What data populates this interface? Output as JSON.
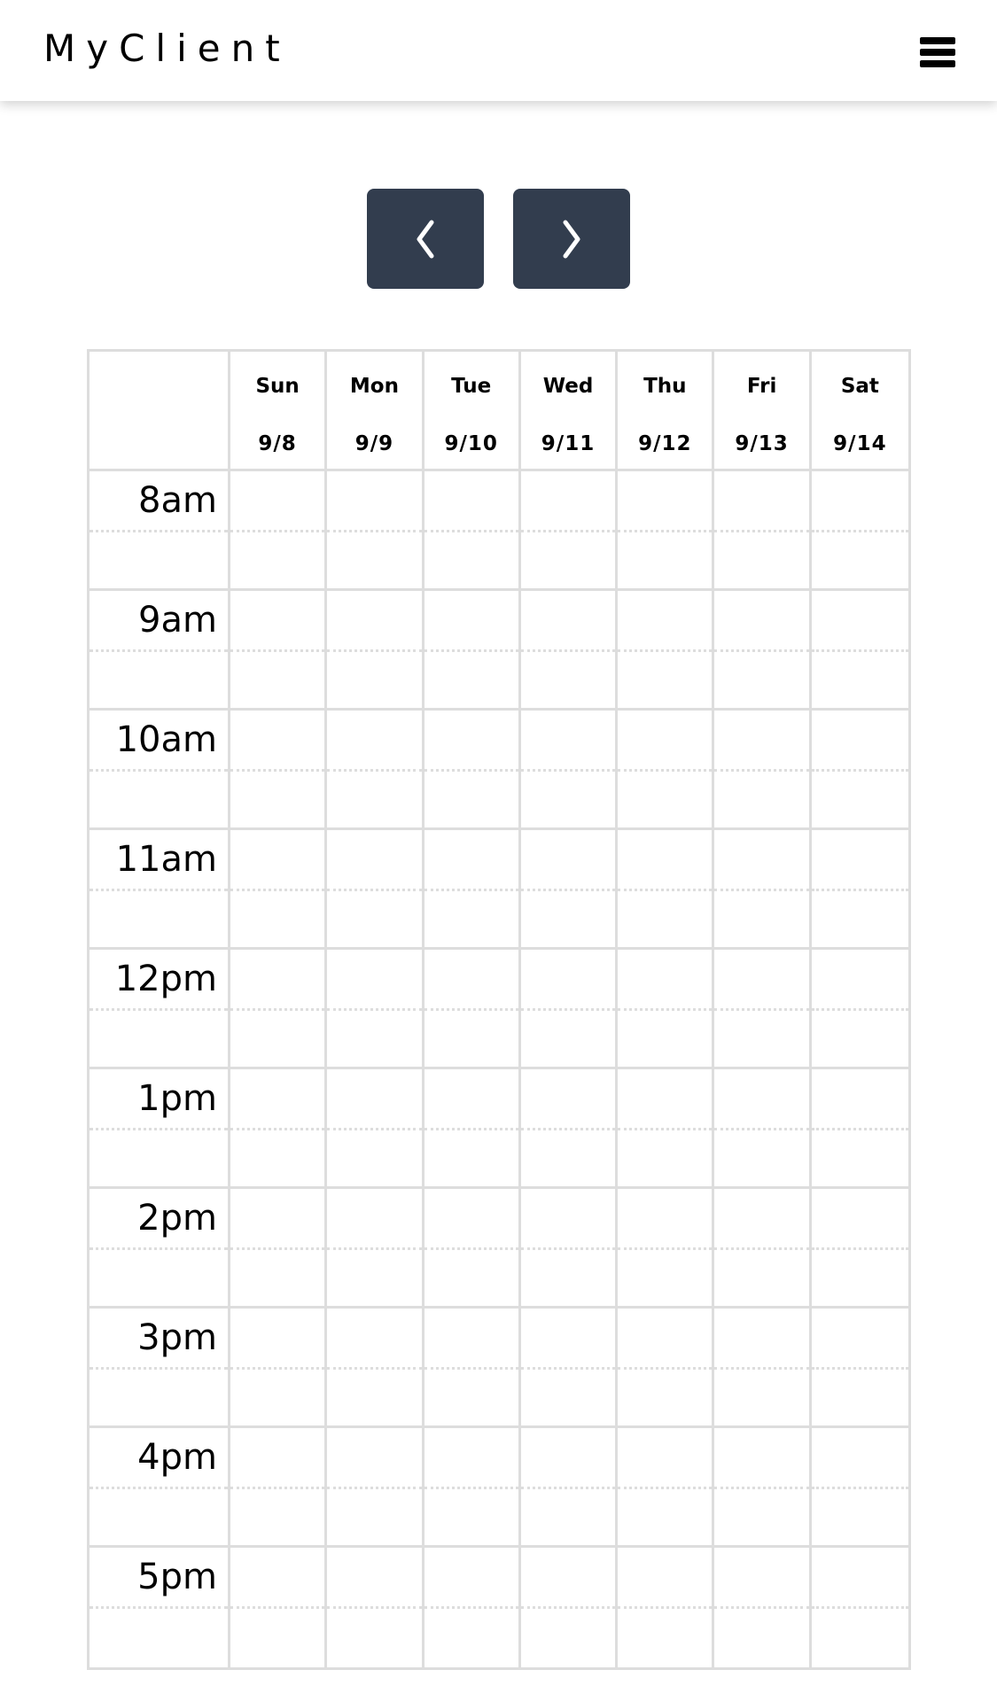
{
  "header": {
    "brand": "MyClient",
    "menu_icon": "hamburger-icon"
  },
  "nav": {
    "prev_icon": "chevron-left-icon",
    "next_icon": "chevron-right-icon",
    "button_color": "#323d4e"
  },
  "days": [
    {
      "day": "Sun",
      "date": "9/8"
    },
    {
      "day": "Mon",
      "date": "9/9"
    },
    {
      "day": "Tue",
      "date": "9/10"
    },
    {
      "day": "Wed",
      "date": "9/11"
    },
    {
      "day": "Thu",
      "date": "9/12"
    },
    {
      "day": "Fri",
      "date": "9/13"
    },
    {
      "day": "Sat",
      "date": "9/14"
    }
  ],
  "hours": [
    "8am",
    "9am",
    "10am",
    "11am",
    "12pm",
    "1pm",
    "2pm",
    "3pm",
    "4pm",
    "5pm"
  ]
}
